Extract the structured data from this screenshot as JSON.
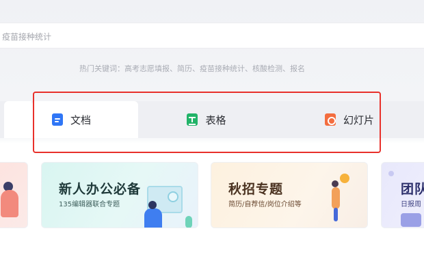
{
  "search": {
    "placeholder": "疫苗接种统计"
  },
  "hot_keywords": {
    "text": "热门关键词：高考志愿填报、简历、疫苗接种统计、核酸检测、报名"
  },
  "tabs": [
    {
      "label": "文档",
      "icon": "doc-icon",
      "active": true
    },
    {
      "label": "表格",
      "icon": "sheet-icon",
      "active": false
    },
    {
      "label": "幻灯片",
      "icon": "slide-icon",
      "active": false
    }
  ],
  "banners": [
    {
      "title": "新人办公必备",
      "subtitle": "135编辑器联合专题"
    },
    {
      "title": "秋招专题",
      "subtitle": "简历/自荐信/岗位介绍等"
    },
    {
      "title": "团队",
      "subtitle": "日报周"
    }
  ],
  "colors": {
    "accent_blue": "#2f76f6",
    "sheet_green": "#21b368",
    "slide_orange": "#f36d3f",
    "highlight_red": "#e8302a"
  }
}
